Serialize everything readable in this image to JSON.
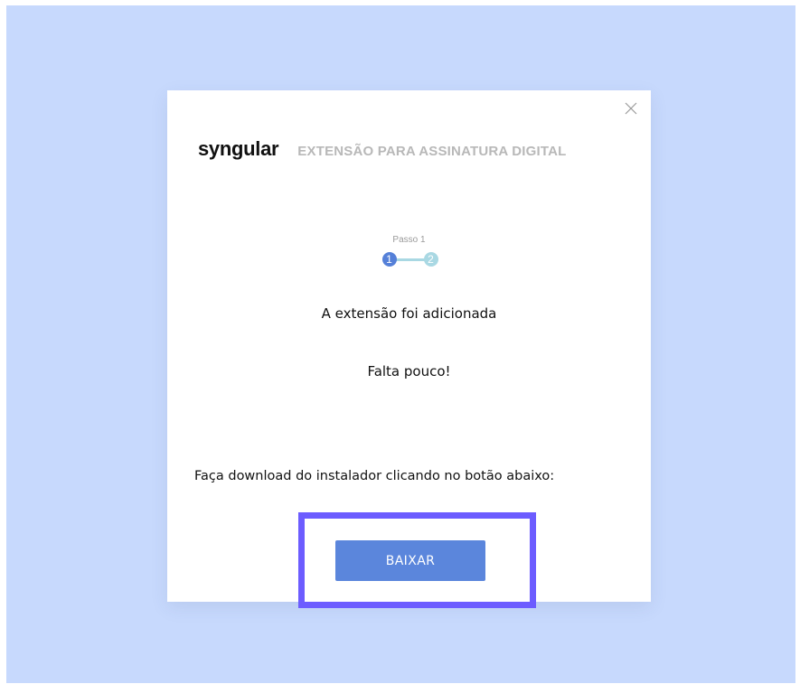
{
  "modal": {
    "brand": "syngular",
    "subtitle": "EXTENSÃO PARA ASSINATURA DIGITAL",
    "close_icon": "close-icon"
  },
  "stepper": {
    "caption": "Passo 1",
    "steps": [
      "1",
      "2"
    ],
    "current_step": 1,
    "active_color": "#5580d8",
    "inactive_color": "#a9d8e3"
  },
  "messages": {
    "added": "A extensão foi adicionada",
    "almost": "Falta pouco!",
    "download_prompt": "Faça download do instalador clicando no botão abaixo:"
  },
  "download_button": {
    "label": "BAIXAR",
    "color": "#5b86dc"
  },
  "colors": {
    "backdrop": "#c7d9fd",
    "highlight": "#6c5cff"
  }
}
